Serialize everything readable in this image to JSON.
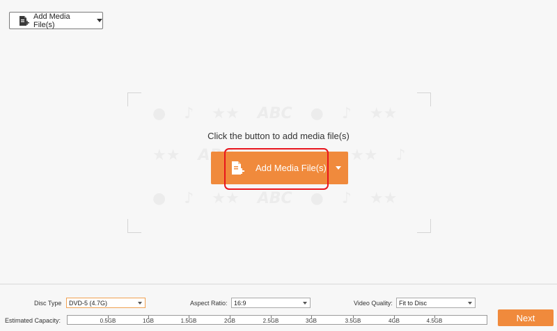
{
  "toolbar": {
    "add_media_label": "Add Media File(s)",
    "add_icon": "add-file-icon",
    "dropdown_icon": "caret-down-icon"
  },
  "drop_area": {
    "instruction": "Click the button to add media file(s)",
    "add_media_label": "Add Media File(s)",
    "watermark_text": "ABC"
  },
  "settings": {
    "disc_type_label": "Disc Type",
    "disc_type_value": "DVD-5 (4.7G)",
    "aspect_ratio_label": "Aspect Ratio:",
    "aspect_ratio_value": "16:9",
    "video_quality_label": "Video Quality:",
    "video_quality_value": "Fit to Disc",
    "capacity_label": "Estimated Capacity:",
    "capacity_ticks": [
      "0.5GB",
      "1GB",
      "1.5GB",
      "2GB",
      "2.5GB",
      "3GB",
      "3.5GB",
      "4GB",
      "4.5GB"
    ]
  },
  "actions": {
    "next_label": "Next"
  },
  "colors": {
    "accent": "#f08a3c",
    "highlight": "#e8141c"
  }
}
